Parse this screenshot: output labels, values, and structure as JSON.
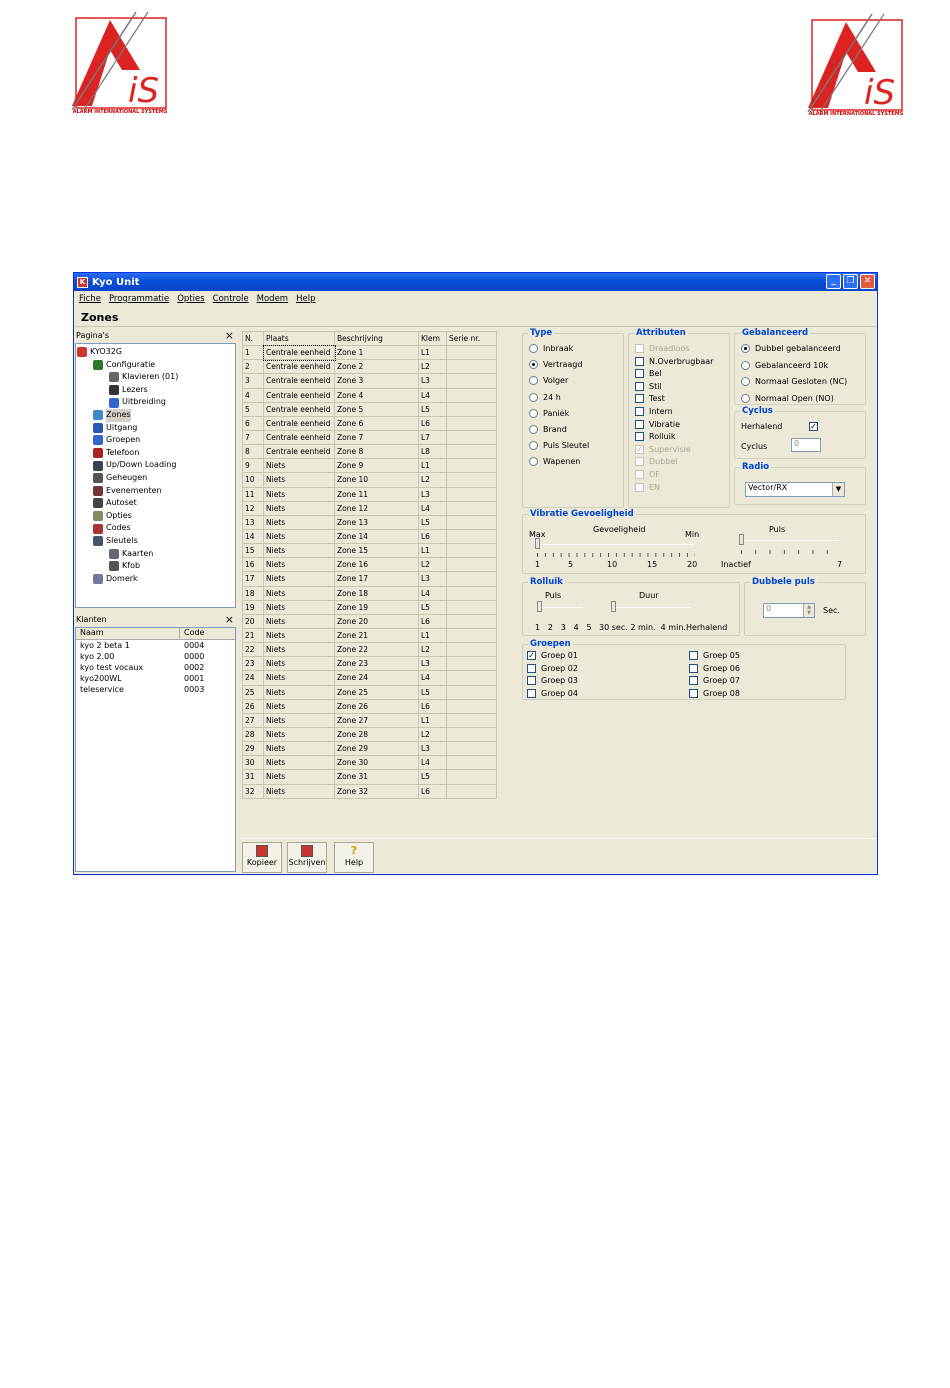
{
  "logos": {
    "caption": "ALARM INTERNATIONAL SYSTEMS"
  },
  "window": {
    "title": "Kyo Unit",
    "menu": [
      "Fiche",
      "Programmatie",
      "Opties",
      "Controle",
      "Modem",
      "Help"
    ],
    "page_title": "Zones"
  },
  "pages_panel": {
    "title": "Pagina's",
    "close": "×",
    "root": "KYO32G",
    "items": [
      {
        "label": "Configuratie",
        "level": 1
      },
      {
        "label": "Klavieren (01)",
        "level": 2
      },
      {
        "label": "Lezers",
        "level": 2
      },
      {
        "label": "Uitbreiding",
        "level": 2
      },
      {
        "label": "Zones",
        "level": 1
      },
      {
        "label": "Uitgang",
        "level": 1
      },
      {
        "label": "Groepen",
        "level": 1
      },
      {
        "label": "Telefoon",
        "level": 1
      },
      {
        "label": "Up/Down Loading",
        "level": 1
      },
      {
        "label": "Geheugen",
        "level": 1
      },
      {
        "label": "Evenementen",
        "level": 1
      },
      {
        "label": "Autoset",
        "level": 1
      },
      {
        "label": "Opties",
        "level": 1
      },
      {
        "label": "Codes",
        "level": 1
      },
      {
        "label": "Sleutels",
        "level": 1
      },
      {
        "label": "Kaarten",
        "level": 2
      },
      {
        "label": "Kfob",
        "level": 2
      },
      {
        "label": "Domerk",
        "level": 1
      }
    ]
  },
  "clients_panel": {
    "title": "Klanten",
    "close": "×",
    "columns": [
      "Naam",
      "Code"
    ],
    "rows": [
      [
        "kyo 2 beta 1",
        "0004"
      ],
      [
        "kyo 2.00",
        "0000"
      ],
      [
        "kyo test vocaux",
        "0002"
      ],
      [
        "kyo200WL",
        "0001"
      ],
      [
        "teleservice",
        "0003"
      ]
    ]
  },
  "zones_table": {
    "columns": [
      "N.",
      "Plaats",
      "Beschrijving",
      "Klem",
      "Serie nr."
    ],
    "rows": [
      [
        "1",
        "Centrale eenheid",
        "Zone 1",
        "L1",
        ""
      ],
      [
        "2",
        "Centrale eenheid",
        "Zone 2",
        "L2",
        ""
      ],
      [
        "3",
        "Centrale eenheid",
        "Zone 3",
        "L3",
        ""
      ],
      [
        "4",
        "Centrale eenheid",
        "Zone 4",
        "L4",
        ""
      ],
      [
        "5",
        "Centrale eenheid",
        "Zone 5",
        "L5",
        ""
      ],
      [
        "6",
        "Centrale eenheid",
        "Zone 6",
        "L6",
        ""
      ],
      [
        "7",
        "Centrale eenheid",
        "Zone 7",
        "L7",
        ""
      ],
      [
        "8",
        "Centrale eenheid",
        "Zone 8",
        "L8",
        ""
      ],
      [
        "9",
        "Niets",
        "Zone 9",
        "L1",
        ""
      ],
      [
        "10",
        "Niets",
        "Zone 10",
        "L2",
        ""
      ],
      [
        "11",
        "Niets",
        "Zone 11",
        "L3",
        ""
      ],
      [
        "12",
        "Niets",
        "Zone 12",
        "L4",
        ""
      ],
      [
        "13",
        "Niets",
        "Zone 13",
        "L5",
        ""
      ],
      [
        "14",
        "Niets",
        "Zone 14",
        "L6",
        ""
      ],
      [
        "15",
        "Niets",
        "Zone 15",
        "L1",
        ""
      ],
      [
        "16",
        "Niets",
        "Zone 16",
        "L2",
        ""
      ],
      [
        "17",
        "Niets",
        "Zone 17",
        "L3",
        ""
      ],
      [
        "18",
        "Niets",
        "Zone 18",
        "L4",
        ""
      ],
      [
        "19",
        "Niets",
        "Zone 19",
        "L5",
        ""
      ],
      [
        "20",
        "Niets",
        "Zone 20",
        "L6",
        ""
      ],
      [
        "21",
        "Niets",
        "Zone 21",
        "L1",
        ""
      ],
      [
        "22",
        "Niets",
        "Zone 22",
        "L2",
        ""
      ],
      [
        "23",
        "Niets",
        "Zone 23",
        "L3",
        ""
      ],
      [
        "24",
        "Niets",
        "Zone 24",
        "L4",
        ""
      ],
      [
        "25",
        "Niets",
        "Zone 25",
        "L5",
        ""
      ],
      [
        "26",
        "Niets",
        "Zone 26",
        "L6",
        ""
      ],
      [
        "27",
        "Niets",
        "Zone 27",
        "L1",
        ""
      ],
      [
        "28",
        "Niets",
        "Zone 28",
        "L2",
        ""
      ],
      [
        "29",
        "Niets",
        "Zone 29",
        "L3",
        ""
      ],
      [
        "30",
        "Niets",
        "Zone 30",
        "L4",
        ""
      ],
      [
        "31",
        "Niets",
        "Zone 31",
        "L5",
        ""
      ],
      [
        "32",
        "Niets",
        "Zone 32",
        "L6",
        ""
      ]
    ]
  },
  "type_group": {
    "label": "Type",
    "options": [
      "Inbraak",
      "Vertraagd",
      "Volger",
      "24 h",
      "Paniek",
      "Brand",
      "Puls Sleutel",
      "Wapenen"
    ],
    "selected": "Vertraagd"
  },
  "attributes_group": {
    "label": "Attributen",
    "options": [
      {
        "label": "Draadloos",
        "checked": false,
        "disabled": true
      },
      {
        "label": "N.Overbrugbaar",
        "checked": false,
        "disabled": false
      },
      {
        "label": "Bel",
        "checked": false,
        "disabled": false
      },
      {
        "label": "Stil",
        "checked": false,
        "disabled": false
      },
      {
        "label": "Test",
        "checked": false,
        "disabled": false
      },
      {
        "label": "Intern",
        "checked": false,
        "disabled": false
      },
      {
        "label": "Vibratie",
        "checked": false,
        "disabled": false
      },
      {
        "label": "Rolluik",
        "checked": false,
        "disabled": false
      },
      {
        "label": "Supervisie",
        "checked": true,
        "disabled": true
      },
      {
        "label": "Dubbel",
        "checked": false,
        "disabled": true
      },
      {
        "label": "OF",
        "checked": false,
        "disabled": true
      },
      {
        "label": "EN",
        "checked": false,
        "disabled": true
      }
    ]
  },
  "balanced_group": {
    "label": "Gebalanceerd",
    "options": [
      "Dubbel gebalanceerd",
      "Gebalanceerd 10k",
      "Normaal Gesloten (NC)",
      "Normaal Open (NO)"
    ],
    "selected": "Dubbel gebalanceerd"
  },
  "cycle_group": {
    "label": "Cyclus",
    "repeat_label": "Herhalend",
    "repeat_checked": true,
    "cycle_label": "Cyclus",
    "cycle_value": "0"
  },
  "radio_group": {
    "label": "Radio",
    "selected": "Vector/RX"
  },
  "vibration_group": {
    "label": "Vibratie Gevoeligheid",
    "sensitivity_label": "Gevoeligheid",
    "max_label": "Max",
    "min_label": "Min",
    "sensitivity_ticks": [
      "1",
      "5",
      "10",
      "15",
      "20"
    ],
    "sensitivity_value": 1,
    "pulse_label": "Puls",
    "pulse_min_label": "Inactief",
    "pulse_max_label": "7",
    "pulse_value": 0
  },
  "rolluik_group": {
    "label": "Rolluik",
    "pulse_label": "Puls",
    "pulse_ticks": [
      "1",
      "2",
      "3",
      "4",
      "5"
    ],
    "pulse_value": 1,
    "duration_label": "Duur",
    "duration_ticks": [
      "30 sec.",
      "2 min.",
      "4 min.",
      "Herhalend"
    ],
    "duration_value": "30 sec."
  },
  "double_pulse_group": {
    "label": "Dubbele puls",
    "value": "0",
    "unit": "Sec."
  },
  "groups_group": {
    "label": "Groepen",
    "items": [
      {
        "label": "Groep 01",
        "checked": true
      },
      {
        "label": "Groep 02",
        "checked": false
      },
      {
        "label": "Groep 03",
        "checked": false
      },
      {
        "label": "Groep 04",
        "checked": false
      },
      {
        "label": "Groep 05",
        "checked": false
      },
      {
        "label": "Groep 06",
        "checked": false
      },
      {
        "label": "Groep 07",
        "checked": false
      },
      {
        "label": "Groep 08",
        "checked": false
      }
    ]
  },
  "toolbar": {
    "copy": "Kopieer",
    "write": "Schrijven",
    "help": "Help"
  }
}
